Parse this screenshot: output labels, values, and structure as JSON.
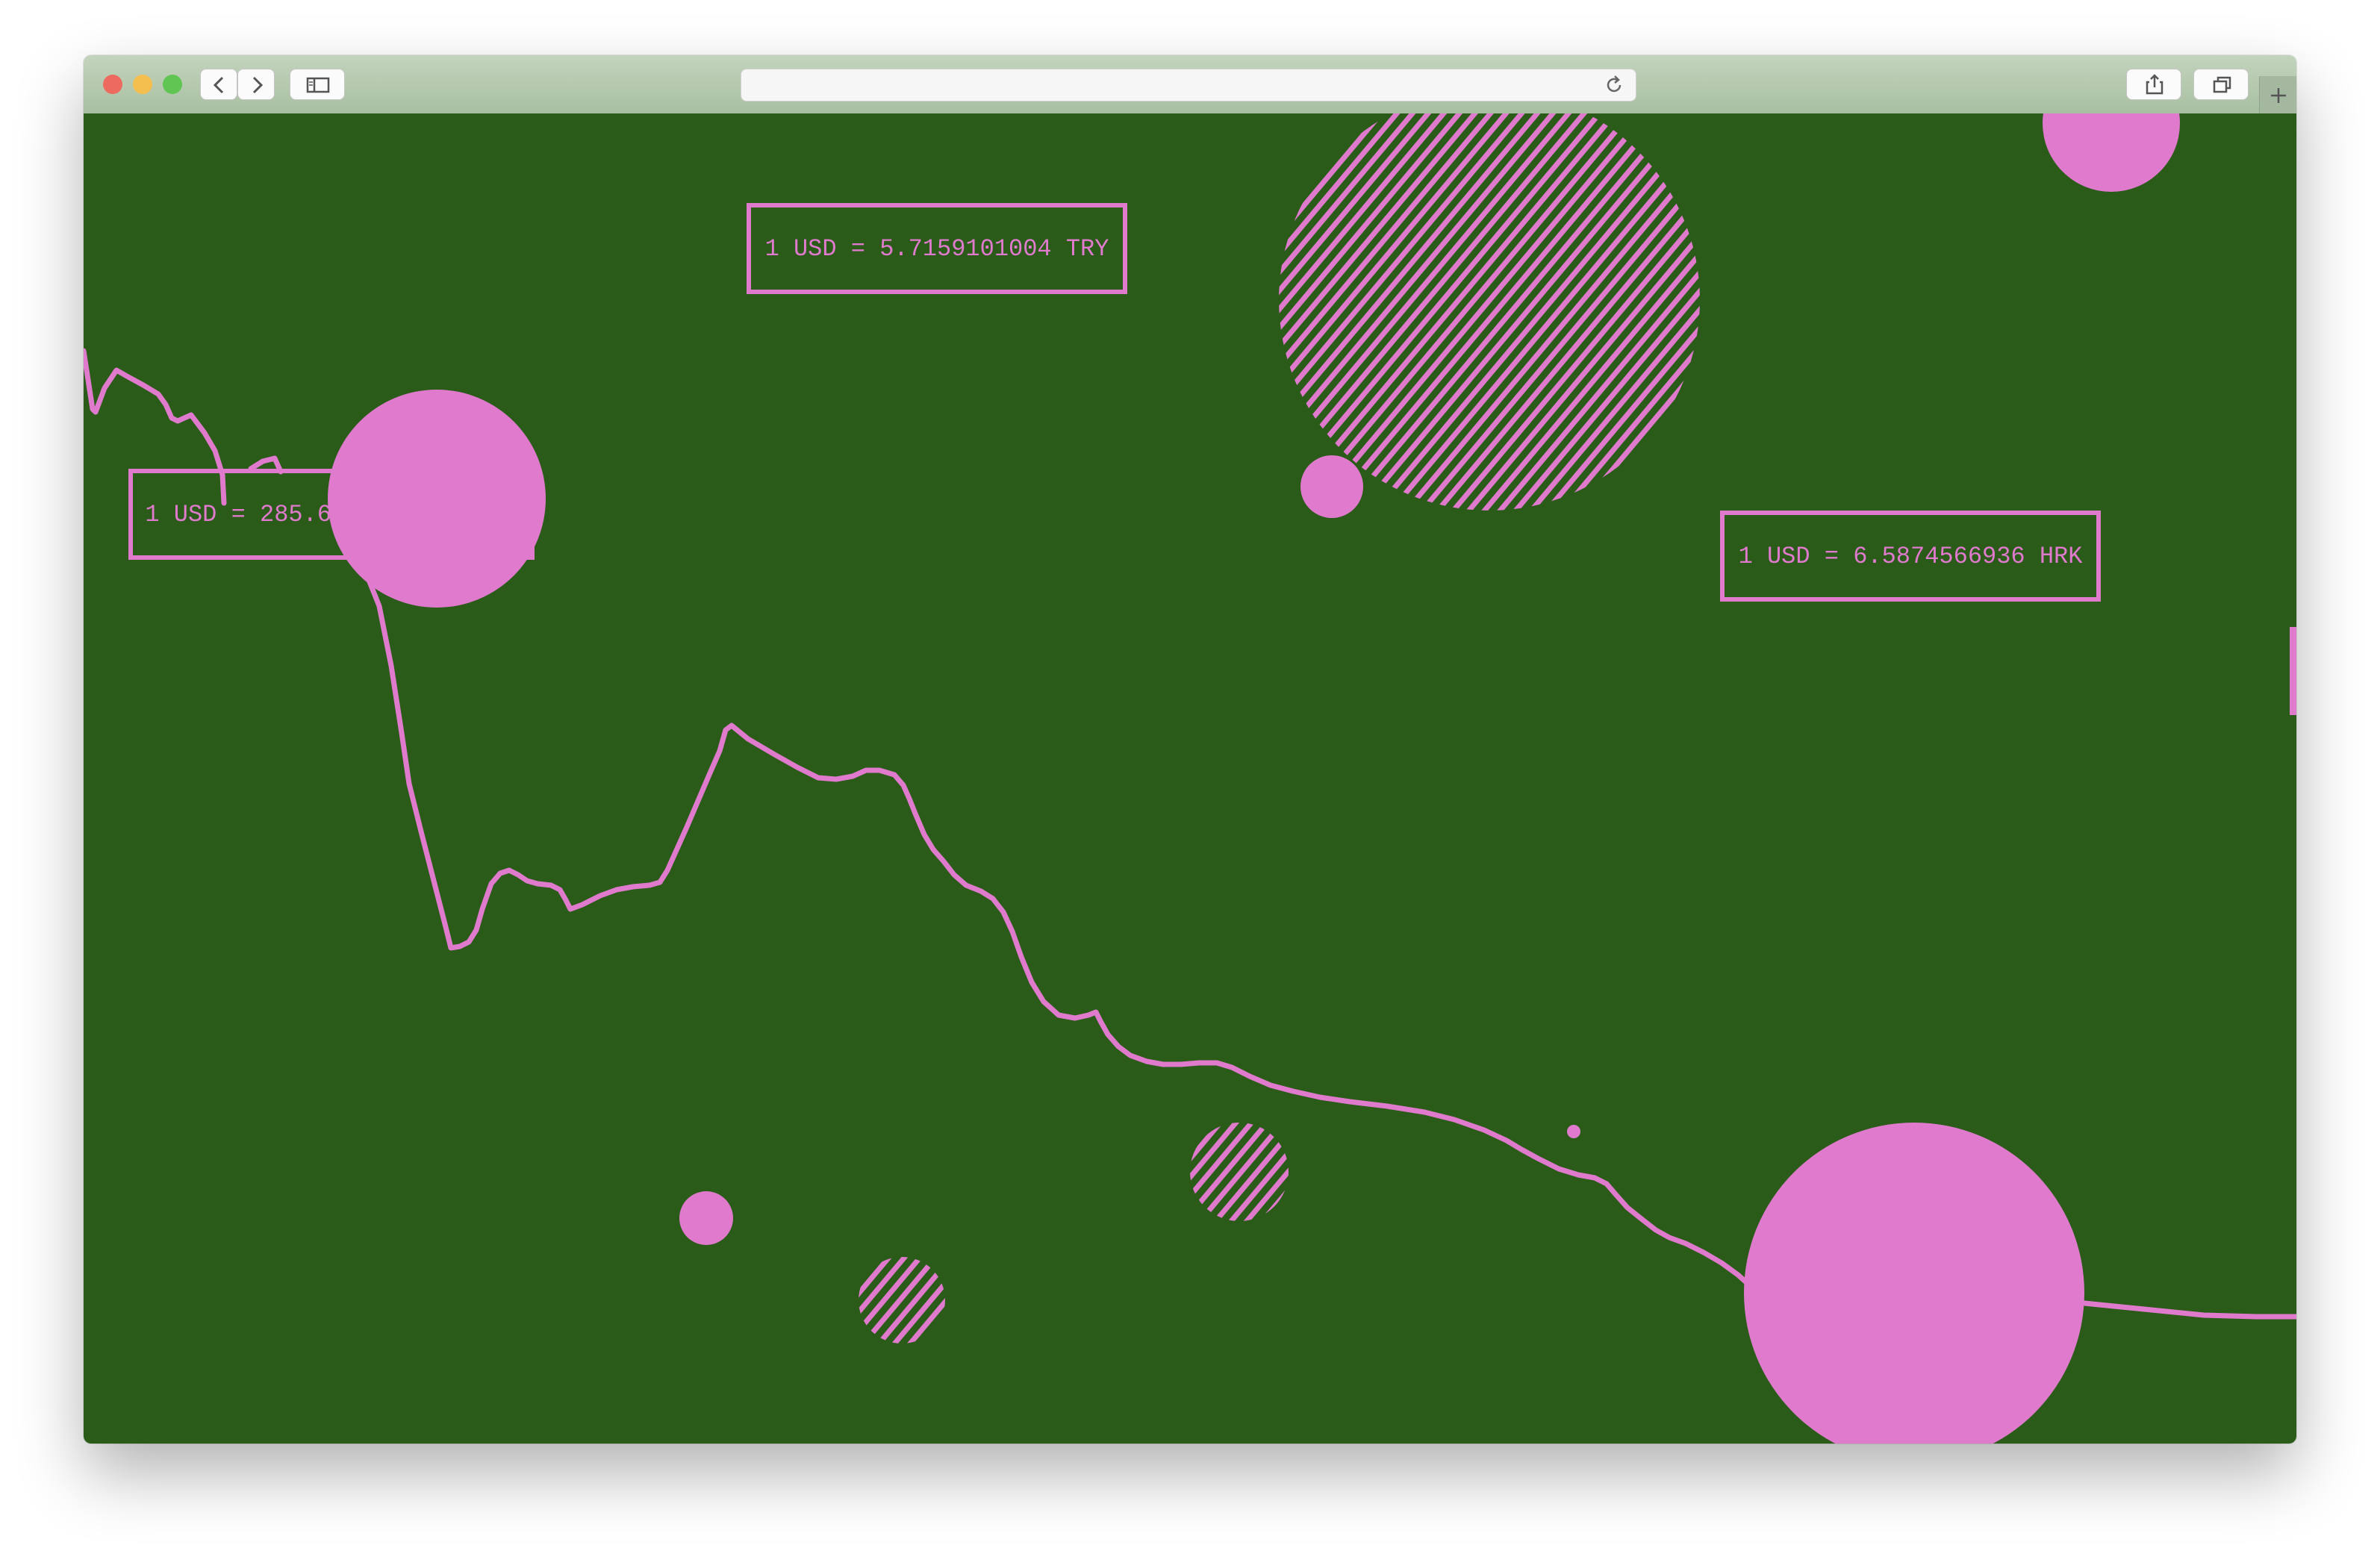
{
  "browser": {
    "url": "",
    "toolbar": {
      "back": "chevron-left-icon",
      "forward": "chevron-right-icon",
      "sidebar": "sidebar-icon",
      "reload": "reload-icon",
      "share": "share-icon",
      "tabs": "tabs-icon",
      "new_tab": "plus-icon"
    }
  },
  "colors": {
    "background": "#2a5b19",
    "accent": "#df7acd",
    "traffic_close": "#ed6a5e",
    "traffic_minimize": "#f5bf4f",
    "traffic_zoom": "#61c554"
  },
  "rates": {
    "huf": "1 USD = 285.6089544284 HUF",
    "try": "1 USD = 5.7159101004 TRY",
    "hrk": "1 USD = 6.5874566936 HRK"
  }
}
